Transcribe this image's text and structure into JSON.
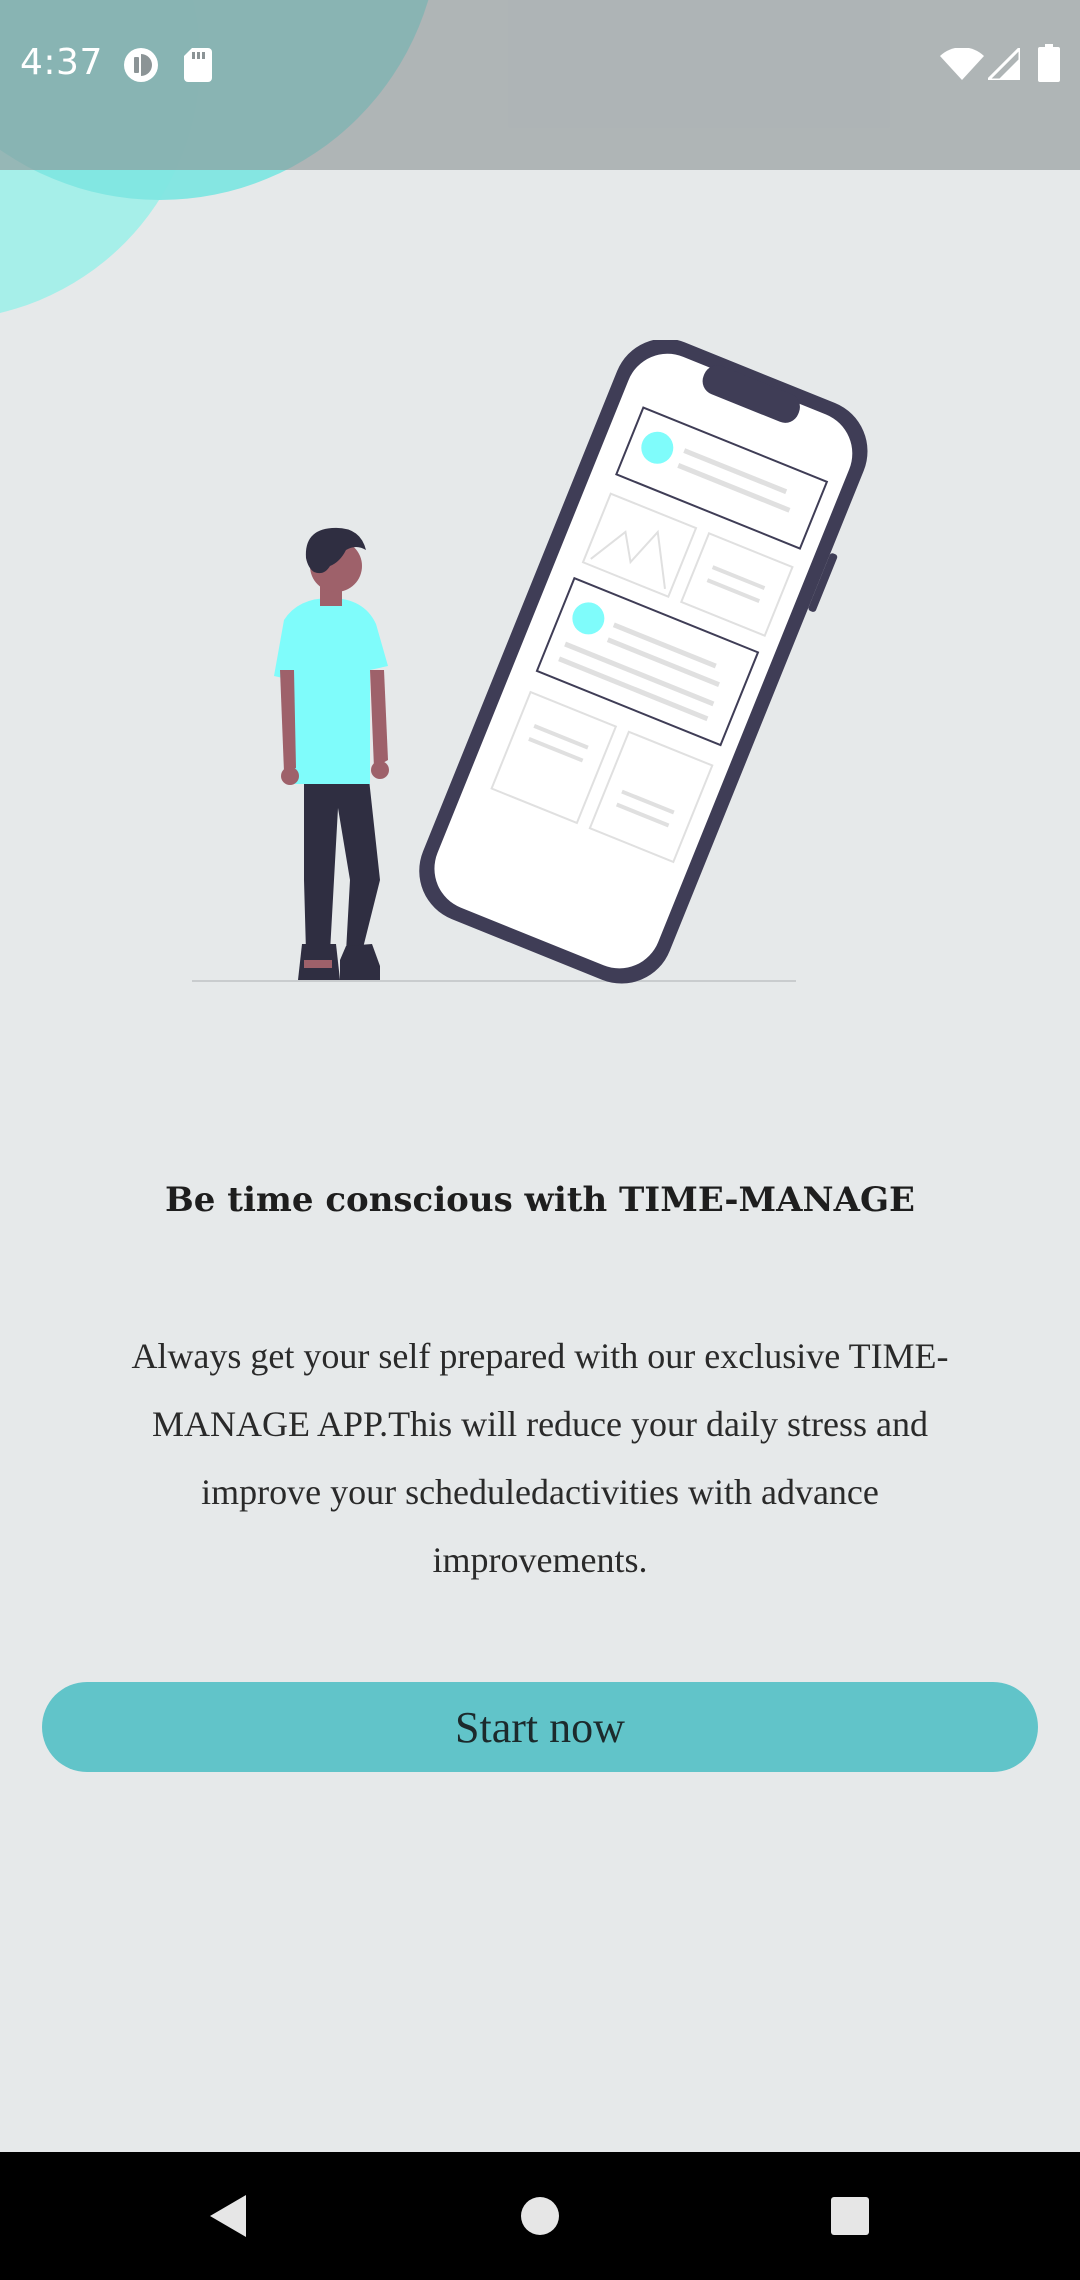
{
  "status_bar": {
    "time": "4:37",
    "icons_left": [
      "data-saver-icon",
      "sd-card-icon"
    ],
    "icons_right": [
      "wifi-icon",
      "cell-signal-icon",
      "battery-icon"
    ]
  },
  "onboarding": {
    "illustration": "person-looking-at-phone-illustration",
    "headline": "Be time conscious with TIME-MANAGE",
    "body": "Always get your self prepared with our exclusive TIME-MANAGE APP.This will reduce your daily stress and improve your scheduledactivities with advance improvements.",
    "start_label": "Start now"
  },
  "nav_bar": {
    "buttons": [
      "back-icon",
      "home-icon",
      "recents-icon"
    ]
  },
  "colors": {
    "background": "#e6e9ea",
    "accent": "#61c4c9",
    "illustration_accent": "#7ffcfb",
    "phone_frame": "#3f3d56"
  }
}
